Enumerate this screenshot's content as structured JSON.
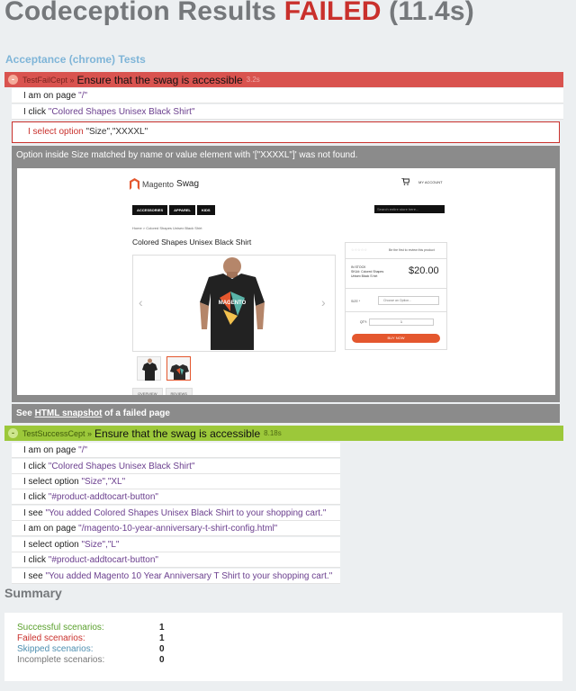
{
  "header": {
    "title": "Codeception Results",
    "status": "FAILED",
    "time": "(11.4s)"
  },
  "suite": {
    "title": "Acceptance (chrome) Tests"
  },
  "failed_scenario": {
    "toggle": "-",
    "cept": "TestFailCept »",
    "title": "Ensure that the swag is accessible",
    "time": "3.2s",
    "steps": [
      {
        "verb": "I am on page ",
        "arg": "\"/\""
      },
      {
        "verb": "I click ",
        "arg": "\"Colored Shapes Unisex Black Shirt\""
      }
    ],
    "failed_step": {
      "verb": "I select option ",
      "arg": "\"Size\",\"XXXXL\""
    },
    "error_message": "Option inside Size matched by name or value element with '[\"XXXXL\"]' was not found.",
    "snapshot": {
      "prefix": "See ",
      "link": "HTML snapshot",
      "suffix": " of a failed page"
    }
  },
  "screenshot": {
    "logo_text": "Magento",
    "logo_suffix": "Swag",
    "cart_icon": "cart-icon",
    "account": "MY ACCOUNT",
    "nav": [
      "ACCESSORIES",
      "APPAREL",
      "KIDS"
    ],
    "search_placeholder": "Search entire store here...",
    "breadcrumb": "Home > Colored Shapes Unisex Black Shirt",
    "product_title": "Colored Shapes Unisex Black Shirt",
    "rating_text": "Be the first to review this product",
    "stock": "IN STOCK",
    "sku": "SKU#: Colored Shapes Unisex Black S hirt",
    "price": "$20.00",
    "size_label": "SIZE *",
    "size_select": "Choose an Option...",
    "qty_label": "QTY:",
    "qty_value": "1",
    "buy_button": "BUY NOW",
    "tabs": [
      "OVERVIEW",
      "REVIEWS"
    ]
  },
  "passed_scenario": {
    "toggle": "-",
    "cept": "TestSuccessCept »",
    "title": "Ensure that the swag is accessible",
    "time": "8.18s",
    "steps": [
      {
        "verb": "I am on page ",
        "arg": "\"/\""
      },
      {
        "verb": "I click ",
        "arg": "\"Colored Shapes Unisex Black Shirt\""
      },
      {
        "verb": "I select option ",
        "arg": "\"Size\",\"XL\""
      },
      {
        "verb": "I click ",
        "arg": "\"#product-addtocart-button\""
      },
      {
        "verb": "I see ",
        "arg": "\"You added Colored Shapes Unisex Black Shirt to your shopping cart.\""
      },
      {
        "verb": "I am on page ",
        "arg": "\"/magento-10-year-anniversary-t-shirt-config.html\""
      },
      {
        "verb": "I select option ",
        "arg": "\"Size\",\"L\""
      },
      {
        "verb": "I click ",
        "arg": "\"#product-addtocart-button\""
      },
      {
        "verb": "I see ",
        "arg": "\"You added Magento 10 Year Anniversary T Shirt to your shopping cart.\""
      }
    ]
  },
  "summary": {
    "heading": "Summary",
    "rows": [
      {
        "label": "Successful scenarios:",
        "value": "1"
      },
      {
        "label": "Failed scenarios:",
        "value": "1"
      },
      {
        "label": "Skipped scenarios:",
        "value": "0"
      },
      {
        "label": "Incomplete scenarios:",
        "value": "0"
      }
    ]
  }
}
